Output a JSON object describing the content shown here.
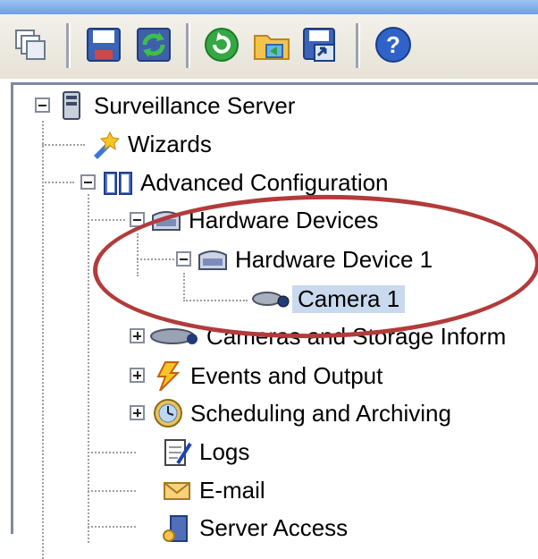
{
  "toolbar": {
    "icons": [
      "tile-windows-icon",
      "save-icon",
      "refresh-apply-icon",
      "restart-icon",
      "folder-open-icon",
      "save-as-icon",
      "help-icon"
    ]
  },
  "tree": {
    "root": "Surveillance Server",
    "wizards": "Wizards",
    "advanced": "Advanced Configuration",
    "hardware_devices": "Hardware Devices",
    "hardware_device_1": "Hardware Device 1",
    "camera_1": "Camera 1",
    "cameras_storage": "Cameras and Storage Inform",
    "events_output": "Events and Output",
    "scheduling": "Scheduling and Archiving",
    "logs": "Logs",
    "email": "E-mail",
    "server_access": "Server Access"
  },
  "colors": {
    "highlight_ellipse": "#b23b3b",
    "selection": "#c9d9ee",
    "toolbar_bg": "#ece9d8"
  }
}
